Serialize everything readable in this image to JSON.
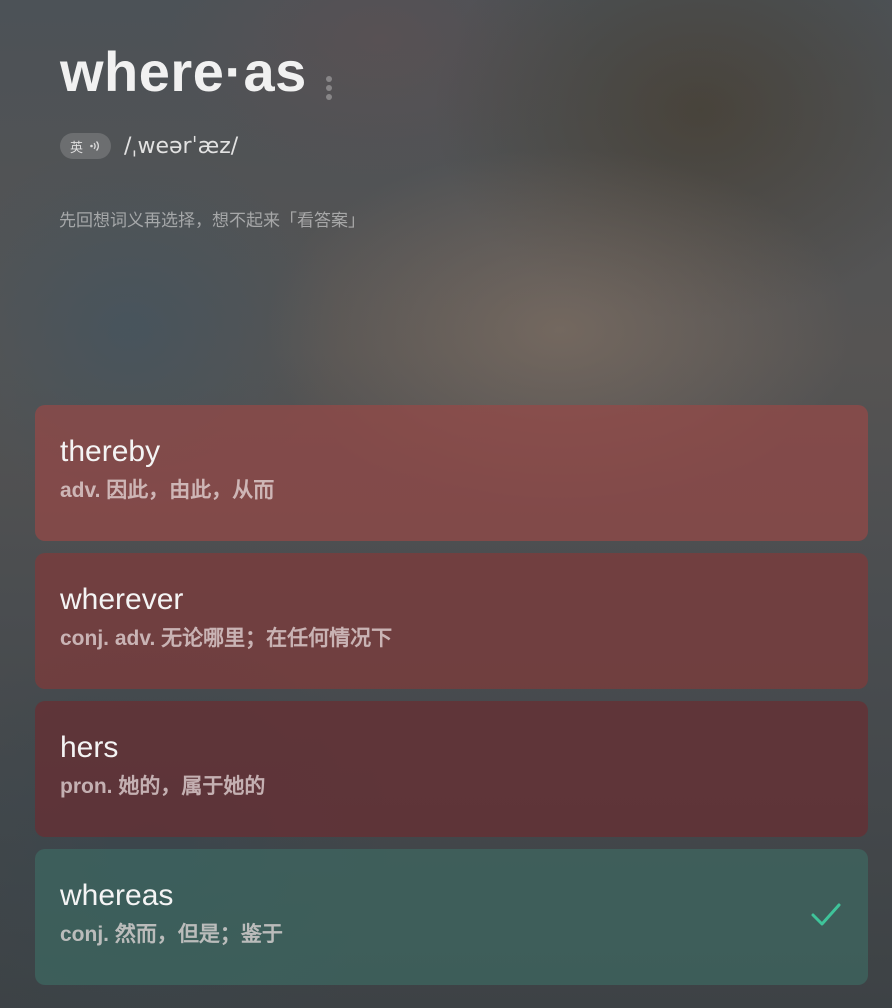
{
  "word": {
    "title": "where·as",
    "lang_badge": "英",
    "phonetic": "/ˌweərˈæz/",
    "hint": "先回想词义再选择，想不起来「看答案」"
  },
  "options": [
    {
      "word": "thereby",
      "definition": "adv. 因此，由此，从而",
      "status": "wrong"
    },
    {
      "word": "wherever",
      "definition": "conj.  adv. 无论哪里；在任何情况下",
      "status": "wrong"
    },
    {
      "word": "hers",
      "definition": "pron. 她的，属于她的",
      "status": "wrong"
    },
    {
      "word": "whereas",
      "definition": "conj. 然而，但是；鉴于",
      "status": "correct"
    }
  ],
  "icons": {
    "more": "more-vertical-icon",
    "speaker": "speaker-icon",
    "check": "check-icon"
  },
  "colors": {
    "wrong": "#96484699",
    "correct": "#3e6e66",
    "check": "#3fc49a"
  }
}
